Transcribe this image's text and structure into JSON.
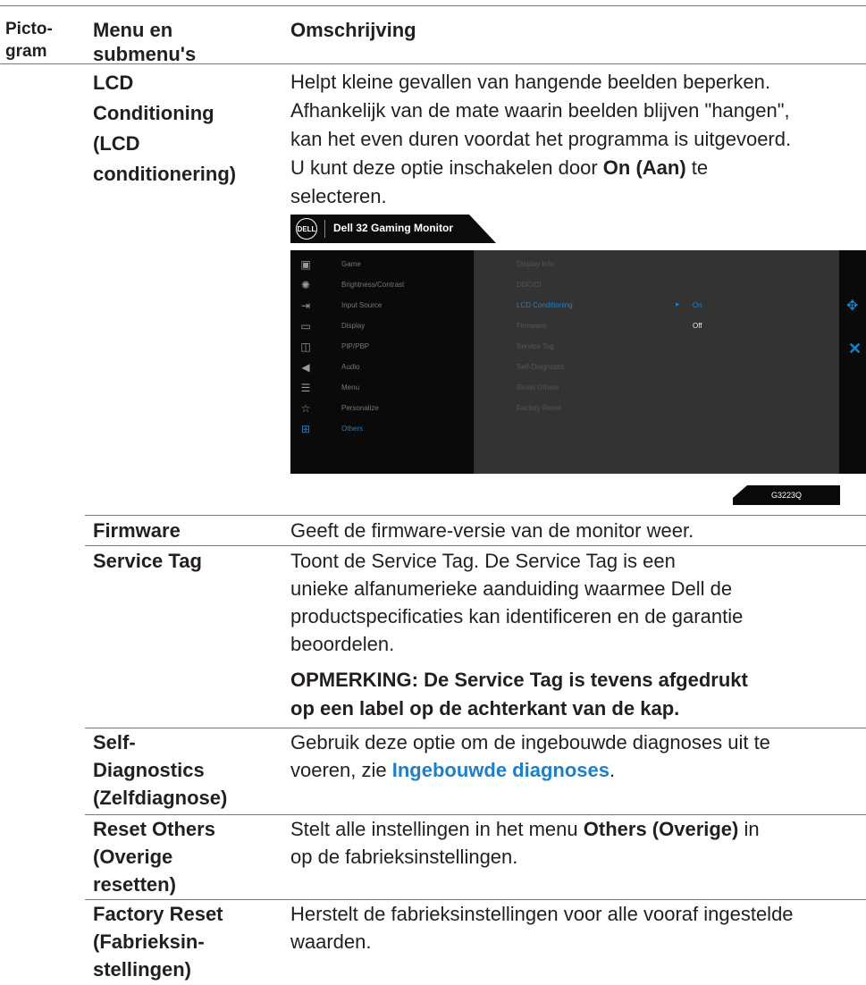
{
  "header": {
    "col1": [
      "Picto-",
      "gram"
    ],
    "col2": [
      "Menu en",
      "submenu's"
    ],
    "col3": "Omschrijving"
  },
  "lcd": {
    "name": [
      "LCD",
      "Conditioning",
      "(LCD",
      "conditionering)"
    ],
    "desc_lines": [
      "Helpt kleine gevallen van hangende beelden beperken.",
      "Afhankelijk van de mate waarin beelden blijven \"hangen\",",
      "kan het even duren voordat het programma is uitgevoerd."
    ],
    "desc_l4_pre": "U kunt deze optie inschakelen door ",
    "desc_l4_bold": "On (Aan)",
    "desc_l4_post": " te",
    "desc_l5": "selecteren."
  },
  "osd": {
    "logo": "DELL",
    "title": "Dell 32 Gaming Monitor",
    "menu": [
      {
        "icon": "game-icon",
        "glyph": "▣",
        "label": "Game"
      },
      {
        "icon": "brightness-icon",
        "glyph": "✺",
        "label": "Brightness/Contrast"
      },
      {
        "icon": "input-source-icon",
        "glyph": "⇥",
        "label": "Input Source"
      },
      {
        "icon": "display-icon",
        "glyph": "▭",
        "label": "Display"
      },
      {
        "icon": "pip-pbp-icon",
        "glyph": "◫",
        "label": "PIP/PBP"
      },
      {
        "icon": "audio-icon",
        "glyph": "◀",
        "label": "Audio"
      },
      {
        "icon": "menu-icon",
        "glyph": "☰",
        "label": "Menu"
      },
      {
        "icon": "personalize-icon",
        "glyph": "☆",
        "label": "Personalize"
      },
      {
        "icon": "others-icon",
        "glyph": "⊞",
        "label": "Others"
      }
    ],
    "active_menu": "Others",
    "submenu": [
      "Display Info",
      "DDC/CI",
      "LCD Conditioning",
      "Firmware",
      "Service Tag",
      "Self-Diagnostic",
      "Reset Others",
      "Factory Reset"
    ],
    "active_submenu": "LCD Conditioning",
    "options": [
      "On",
      "Off"
    ],
    "selected_option": "On",
    "model": "G3223Q",
    "colors": {
      "accent": "#1f7fc6",
      "panel": "#333333",
      "background": "#0a0a0a"
    }
  },
  "firmware": {
    "name": "Firmware",
    "desc": "Geeft de firmware-versie van de monitor weer."
  },
  "service_tag": {
    "name": "Service Tag",
    "desc_lines": [
      "Toont de Service Tag. De Service Tag is een",
      "unieke alfanumerieke aanduiding waarmee Dell de",
      "productspecificaties kan identificeren en de garantie",
      "beoordelen."
    ],
    "note_lines": [
      "OPMERKING: De Service Tag is tevens afgedrukt",
      "op een label op de achterkant van de kap."
    ]
  },
  "self_diag": {
    "name": [
      "Self-",
      "Diagnostics",
      "(Zelfdiagnose)"
    ],
    "desc_l1": "Gebruik deze optie om de ingebouwde diagnoses uit te",
    "desc_l2_pre": "voeren, zie ",
    "desc_l2_link": "Ingebouwde diagnoses",
    "desc_l2_post": "."
  },
  "reset_others": {
    "name": [
      "Reset Others",
      "(Overige",
      "resetten)"
    ],
    "desc_l1_pre": "Stelt alle instellingen in het menu ",
    "desc_l1_bold": "Others (Overige)",
    "desc_l1_post": " in",
    "desc_l2": "op de fabrieksinstellingen."
  },
  "factory_reset": {
    "name": [
      "Factory Reset",
      "(Fabrieksin-",
      "stellingen)"
    ],
    "desc_lines": [
      "Herstelt de fabrieksinstellingen voor alle vooraf ingestelde",
      "waarden."
    ]
  }
}
